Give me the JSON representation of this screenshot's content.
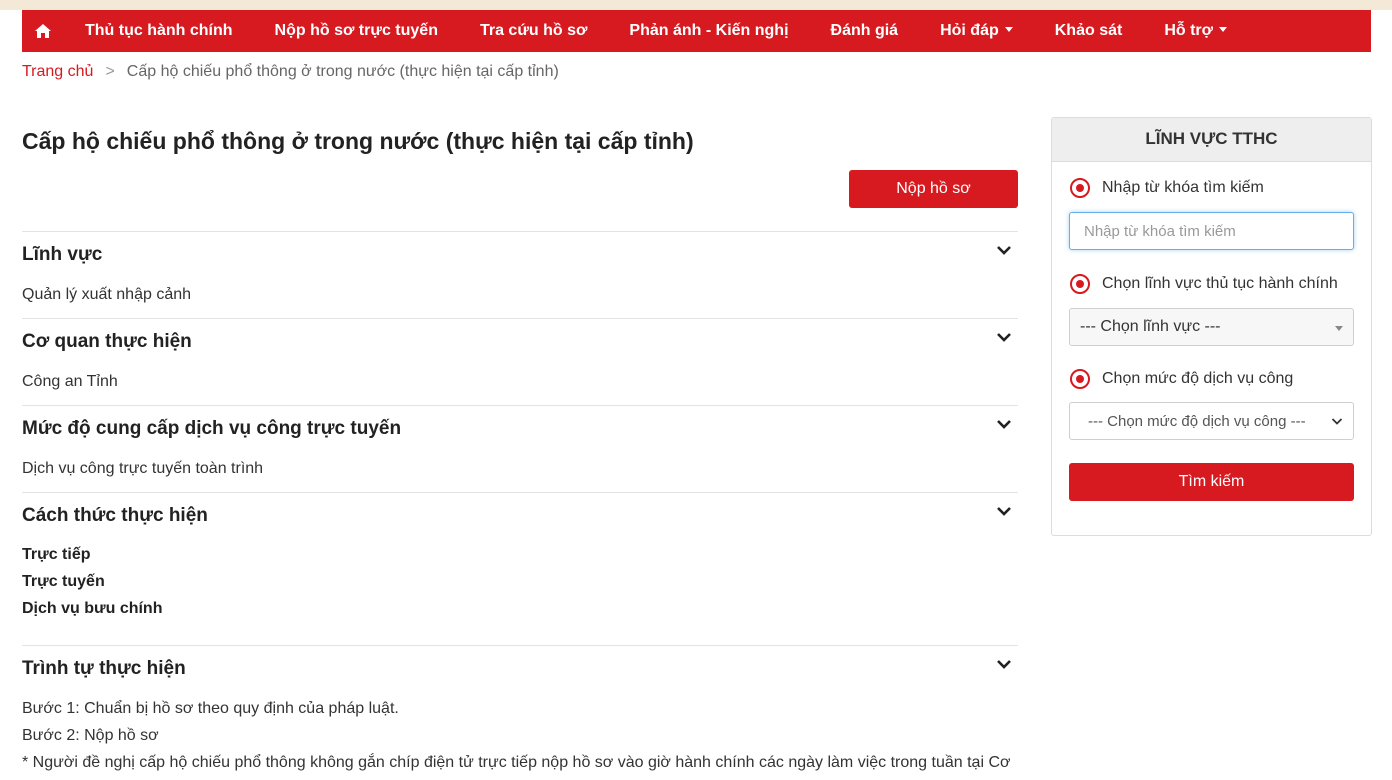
{
  "colors": {
    "brand": "#d71920",
    "focus": "#66afe9"
  },
  "nav": {
    "home_icon": "home-icon",
    "items": [
      {
        "label": "Thủ tục hành chính"
      },
      {
        "label": "Nộp hồ sơ trực tuyến"
      },
      {
        "label": "Tra cứu hồ sơ"
      },
      {
        "label": "Phản ánh - Kiến nghị"
      },
      {
        "label": "Đánh giá"
      },
      {
        "label": "Hỏi đáp"
      },
      {
        "label": "Khảo sát"
      },
      {
        "label": "Hỗ trợ"
      }
    ]
  },
  "breadcrumb": {
    "home": "Trang chủ",
    "separator": ">",
    "current": "Cấp hộ chiếu phổ thông ở trong nước (thực hiện tại cấp tỉnh)"
  },
  "main": {
    "title": "Cấp hộ chiếu phổ thông ở trong nước (thực hiện tại cấp tỉnh)",
    "submit_label": "Nộp hồ sơ",
    "sections": [
      {
        "title": "Lĩnh vực",
        "lines": [
          "Quản lý xuất nhập cảnh"
        ]
      },
      {
        "title": "Cơ quan thực hiện",
        "lines": [
          "Công an Tỉnh"
        ]
      },
      {
        "title": "Mức độ cung cấp dịch vụ công trực tuyến",
        "lines": [
          "Dịch vụ công trực tuyến toàn trình"
        ]
      },
      {
        "title": "Cách thức thực hiện",
        "lines": [
          "Trực tiếp",
          "Trực tuyến",
          "Dịch vụ bưu chính"
        ]
      },
      {
        "title": "Trình tự thực hiện",
        "lines": [
          "Bước 1: Chuẩn bị hồ sơ theo quy định của pháp luật.",
          "Bước 2: Nộp hồ sơ",
          "* Người đề nghị cấp hộ chiếu phổ thông không gắn chíp điện tử trực tiếp nộp hồ sơ vào giờ hành chính các ngày làm việc trong tuần tại Cơ"
        ]
      }
    ]
  },
  "sidebar": {
    "title": "LĨNH VỰC TTHC",
    "keyword_radio": "Nhập từ khóa tìm kiếm",
    "keyword_placeholder": "Nhập từ khóa tìm kiếm",
    "field_radio": "Chọn lĩnh vực thủ tục hành chính",
    "field_select": "--- Chọn lĩnh vực ---",
    "level_radio": "Chọn mức độ dịch vụ công",
    "level_select": "--- Chọn mức độ dịch vụ công ---",
    "search_label": "Tìm kiếm"
  }
}
